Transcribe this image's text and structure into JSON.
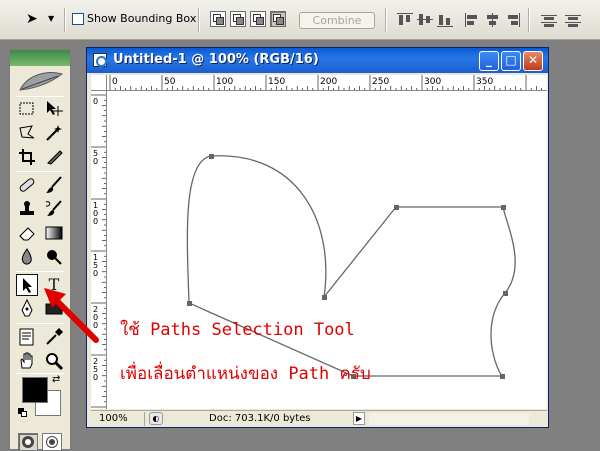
{
  "options_bar": {
    "show_bounding_box_label": "Show Bounding Box",
    "show_bounding_box_checked": false,
    "combine_label": "Combine",
    "path_area_modes": [
      "add-to-path-area",
      "subtract-from-path-area",
      "intersect-path-areas",
      "exclude-overlapping-path-areas"
    ],
    "active_mode_index": 3
  },
  "toolbox": {
    "tools": [
      {
        "row": 0,
        "left": "rectangular-marquee-icon",
        "right": "move-icon"
      },
      {
        "row": 1,
        "left": "lasso-icon",
        "right": "magic-wand-icon"
      },
      {
        "row": 2,
        "left": "crop-icon",
        "right": "slice-icon"
      },
      {
        "row": 3,
        "left": "healing-brush-icon",
        "right": "brush-icon"
      },
      {
        "row": 4,
        "left": "clone-stamp-icon",
        "right": "history-brush-icon"
      },
      {
        "row": 5,
        "left": "eraser-icon",
        "right": "gradient-icon"
      },
      {
        "row": 6,
        "left": "blur-icon",
        "right": "dodge-icon"
      },
      {
        "row": 7,
        "left": "path-selection-icon",
        "right": "type-icon"
      },
      {
        "row": 8,
        "left": "pen-icon",
        "right": "shape-icon"
      },
      {
        "row": 9,
        "left": "notes-icon",
        "right": "eyedropper-icon"
      },
      {
        "row": 10,
        "left": "hand-icon",
        "right": "zoom-icon"
      }
    ],
    "type_tool_glyph": "T",
    "selected_tool": "path-selection-icon",
    "foreground_color": "#000000",
    "background_color": "#ffffff"
  },
  "document": {
    "title": "Untitled-1 @ 100% (RGB/16)",
    "ruler_top_labels": [
      "0",
      "50",
      "100",
      "150",
      "200",
      "250",
      "300",
      "350"
    ],
    "ruler_left_labels": [
      "0",
      "5 0",
      "1 0 0",
      "1 5 0",
      "2 0 0",
      "2 5 0"
    ],
    "zoom": "100%",
    "doc_info": "Doc: 703.1K/0 bytes",
    "minimize_glyph": "_",
    "maximize_glyph": "□",
    "close_glyph": "✕"
  },
  "annotation": {
    "line1": "ใช้ Paths Selection Tool",
    "line2": "เพื่อเลื่อนตำแหน่งของ Path ครับ",
    "color": "#e00000"
  }
}
